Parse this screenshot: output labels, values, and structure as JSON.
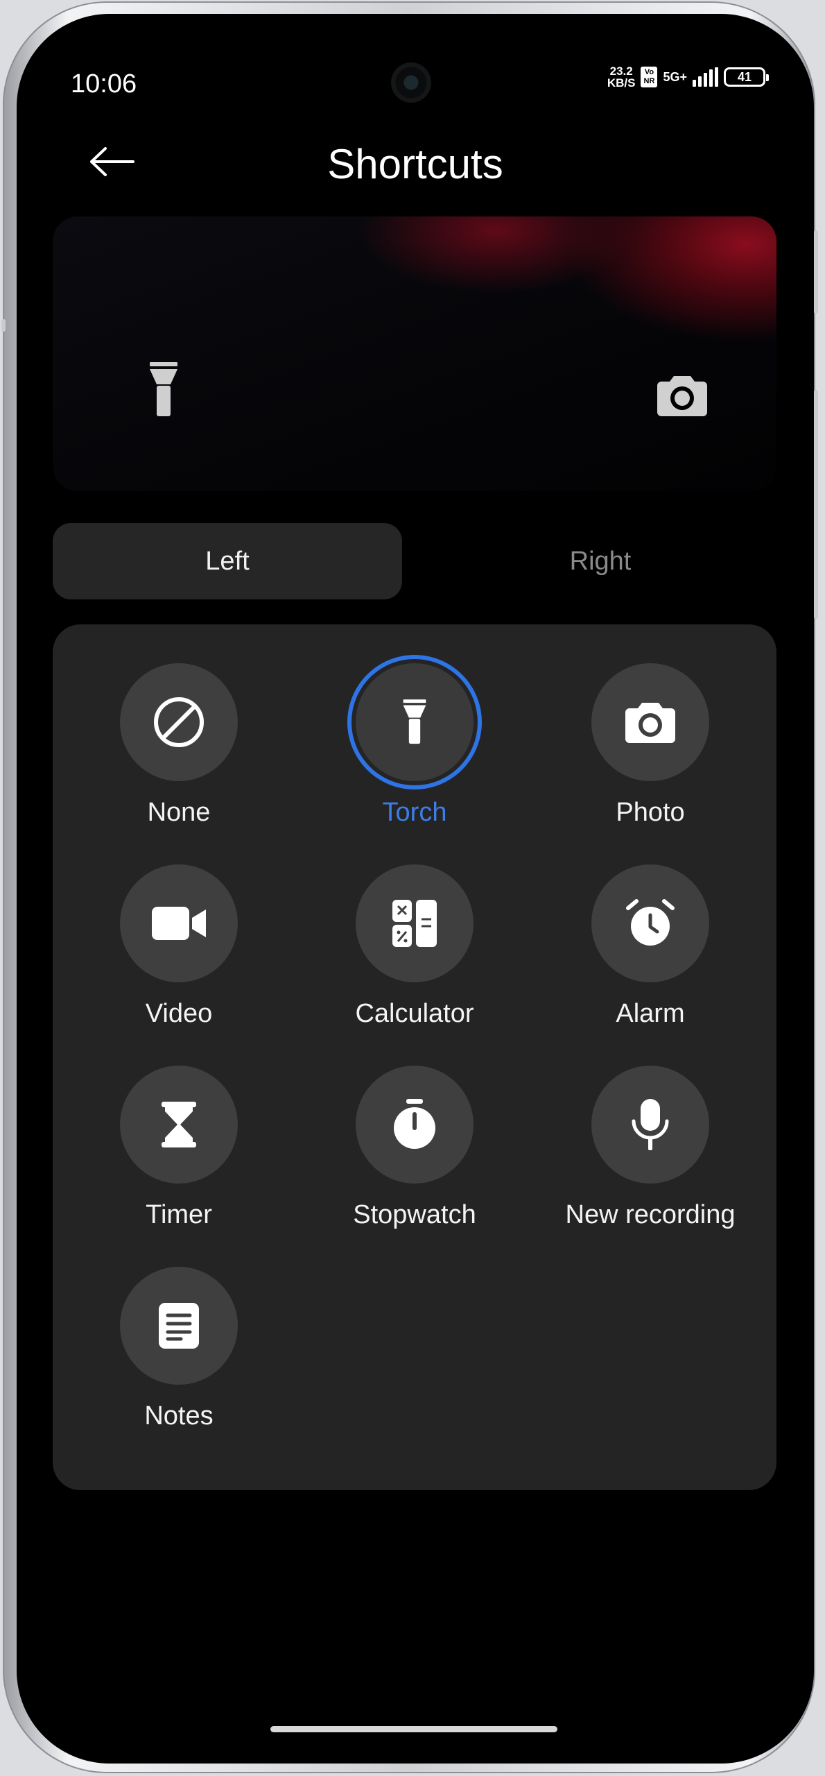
{
  "status_bar": {
    "time": "10:06",
    "net_speed_value": "23.2",
    "net_speed_unit": "KB/S",
    "volte_top": "Vo",
    "volte_bottom": "NR",
    "network": "5G+",
    "battery": "41"
  },
  "header": {
    "back_icon": "arrow-left-icon",
    "title": "Shortcuts"
  },
  "preview": {
    "left_icon": "torch-icon",
    "right_icon": "camera-icon"
  },
  "segment": {
    "left_label": "Left",
    "right_label": "Right",
    "selected": "Left"
  },
  "shortcuts": [
    {
      "label": "None",
      "icon": "none-icon",
      "selected": false
    },
    {
      "label": "Torch",
      "icon": "torch-icon",
      "selected": true
    },
    {
      "label": "Photo",
      "icon": "camera-icon",
      "selected": false
    },
    {
      "label": "Video",
      "icon": "video-icon",
      "selected": false
    },
    {
      "label": "Calculator",
      "icon": "calculator-icon",
      "selected": false
    },
    {
      "label": "Alarm",
      "icon": "alarm-icon",
      "selected": false
    },
    {
      "label": "Timer",
      "icon": "hourglass-icon",
      "selected": false
    },
    {
      "label": "Stopwatch",
      "icon": "stopwatch-icon",
      "selected": false
    },
    {
      "label": "New recording",
      "icon": "microphone-icon",
      "selected": false
    },
    {
      "label": "Notes",
      "icon": "notes-icon",
      "selected": false
    }
  ],
  "colors": {
    "accent": "#2f74e4",
    "background": "#000000",
    "panel": "#242424",
    "icon_circle": "#3f3f3f"
  }
}
